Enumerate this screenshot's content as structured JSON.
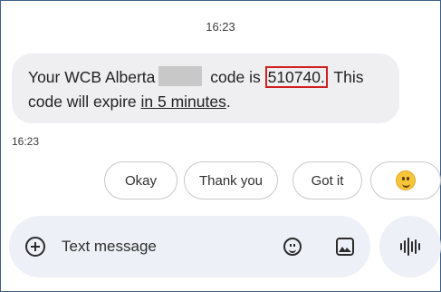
{
  "conversation": {
    "top_timestamp": "16:23",
    "message": {
      "part1": "Your WCB Alberta",
      "part2": " code is ",
      "code": "510740.",
      "part3": " This",
      "part4": "code will expire ",
      "underline_text": "in 5 minutes",
      "part5": ".",
      "timestamp": "16:23"
    },
    "smart_replies": [
      "Okay",
      "Thank you",
      "Got it"
    ]
  },
  "composer": {
    "placeholder": "Text message",
    "icons": [
      "add-icon",
      "emoji-icon",
      "gallery-icon",
      "voice-icon"
    ]
  },
  "colors": {
    "highlight_border": "#d01f1f",
    "bubble_bg": "#efeff2",
    "composer_bg": "#edf0f6",
    "frame_border": "#3d5f86"
  }
}
